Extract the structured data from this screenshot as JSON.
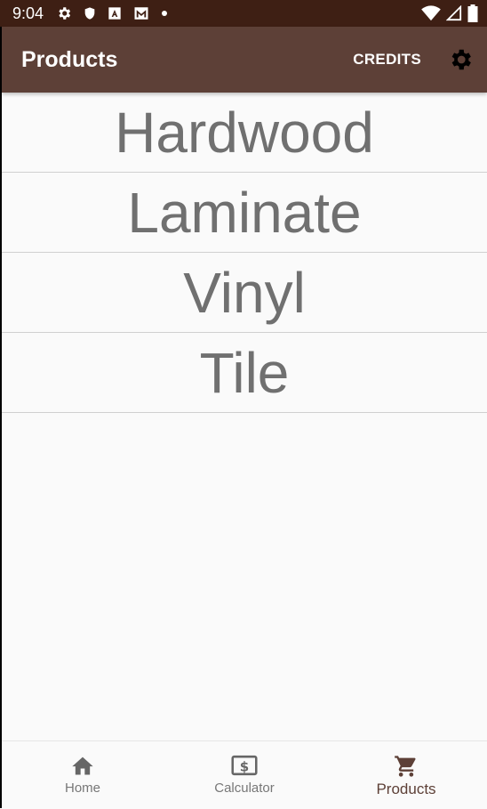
{
  "status_bar": {
    "time": "9:04",
    "left_icons": [
      "settings-icon",
      "shield-icon",
      "text-icon",
      "mail-icon",
      "dot-icon"
    ],
    "right_icons": [
      "wifi-icon",
      "signal-icon",
      "battery-icon"
    ]
  },
  "app_bar": {
    "title": "Products",
    "credits_label": "CREDITS",
    "settings_icon": "gear-icon",
    "background": "#5d4037"
  },
  "products": [
    {
      "label": "Hardwood"
    },
    {
      "label": "Laminate"
    },
    {
      "label": "Vinyl"
    },
    {
      "label": "Tile"
    }
  ],
  "bottom_nav": {
    "items": [
      {
        "label": "Home",
        "icon": "home-icon",
        "active": false
      },
      {
        "label": "Calculator",
        "icon": "calculator-icon",
        "active": false
      },
      {
        "label": "Products",
        "icon": "cart-icon",
        "active": true
      }
    ],
    "active_color": "#5d4037",
    "inactive_color": "#777777"
  }
}
